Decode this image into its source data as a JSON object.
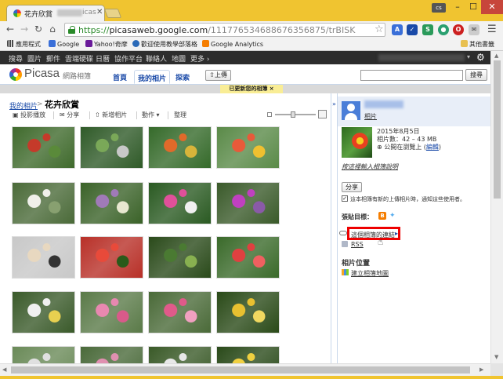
{
  "browser": {
    "tab_title": "花卉欣賞",
    "tab_title_suffix": "icas",
    "user_badge": "cs",
    "window_controls": {
      "minimize": "–",
      "maximize": "☐",
      "close": "✕"
    },
    "url_scheme": "https://",
    "url_host": "picasaweb.google.com",
    "url_path": "/111776534688676356875/trBISK",
    "bookmarks": [
      "應用程式",
      "Google",
      "Yahoo!奇摩",
      "歡迎使用教學部落格",
      "Google Analytics"
    ],
    "other_bookmarks": "其他書籤",
    "ext_colors": [
      "#3a6fd8",
      "#1a4aa8",
      "#2a9a5a",
      "#2aa070",
      "#cc2020"
    ]
  },
  "google_bar": {
    "items": [
      "搜尋",
      "圖片",
      "郵件",
      "雲端硬碟",
      "日曆",
      "協作平台",
      "聯絡人",
      "地圖",
      "更多 ›"
    ]
  },
  "picasa": {
    "logo_text": "Picasa",
    "logo_sub": "網路相簿",
    "tabs": [
      "首頁",
      "我的相片",
      "探索"
    ],
    "upload_label": "上傳",
    "search_button": "搜尋",
    "notice": "已更新您的相簿 ×"
  },
  "album": {
    "breadcrumb": "我的相片",
    "breadcrumb_sep": ">",
    "title": "花卉欣賞",
    "actions": [
      "投影播放",
      "分享",
      "新增相片",
      "動作 ▾",
      "整理"
    ]
  },
  "sidebar": {
    "user_link": "相片",
    "date": "2015年8月5日",
    "count": "相片數：42 – 43 MB",
    "visibility": "公開在瀏覽上 (",
    "edit_link": "編輯",
    "visibility_close": ")",
    "describe_link": "按這裡輸入相簿說明",
    "share_button": "分享",
    "notify_text": "這本相簿有新的上傳相片時，通知這些使用者。",
    "blog_label": "張貼目標：",
    "album_link": "這個相簿的連結",
    "rss": "RSS",
    "location_heading": "相片位置",
    "map_link": "建立相簿地圖"
  },
  "thumb_colors": [
    [
      "#3f6a2c",
      "#c53a2a",
      "#5a8a3a"
    ],
    [
      "#2f5a28",
      "#7aa858",
      "#c8c8c8"
    ],
    [
      "#356a2a",
      "#e06a2a",
      "#d8b43a"
    ],
    [
      "#5a8a48",
      "#e85a3a",
      "#f0c030"
    ],
    [
      "#4a6a38",
      "#f0f0ea",
      "#88a070"
    ],
    [
      "#3a6228",
      "#a07ab8",
      "#e8e8d0"
    ],
    [
      "#2a5a22",
      "#e0509a",
      "#f0f0f0"
    ],
    [
      "#3a5a2a",
      "#c040c0",
      "#8a5aa8"
    ],
    [
      "#c8c8c8",
      "#e8d8c0",
      "#333333"
    ],
    [
      "#b83028",
      "#e84a3a",
      "#2a5a1a"
    ],
    [
      "#2a4a1a",
      "#4a7a32",
      "#88b050"
    ],
    [
      "#3a6a2a",
      "#e04040",
      "#f06060"
    ],
    [
      "#3a5a2a",
      "#f0f0f0",
      "#e8d050"
    ],
    [
      "#5a7a48",
      "#e888b0",
      "#d85a8a"
    ],
    [
      "#4a6a38",
      "#e05a8a",
      "#f0a0c0"
    ],
    [
      "#2a4a18",
      "#e8c030",
      "#f0d860"
    ],
    [
      "#6a8a58",
      "#e0e0e0",
      "#a8c888"
    ],
    [
      "#4a6a3a",
      "#e090b0",
      "#c8c8c8"
    ],
    [
      "#3a5a28",
      "#e8e8e8",
      "#90b070"
    ],
    [
      "#2a4a1a",
      "#f0d040",
      "#6a8a40"
    ]
  ]
}
